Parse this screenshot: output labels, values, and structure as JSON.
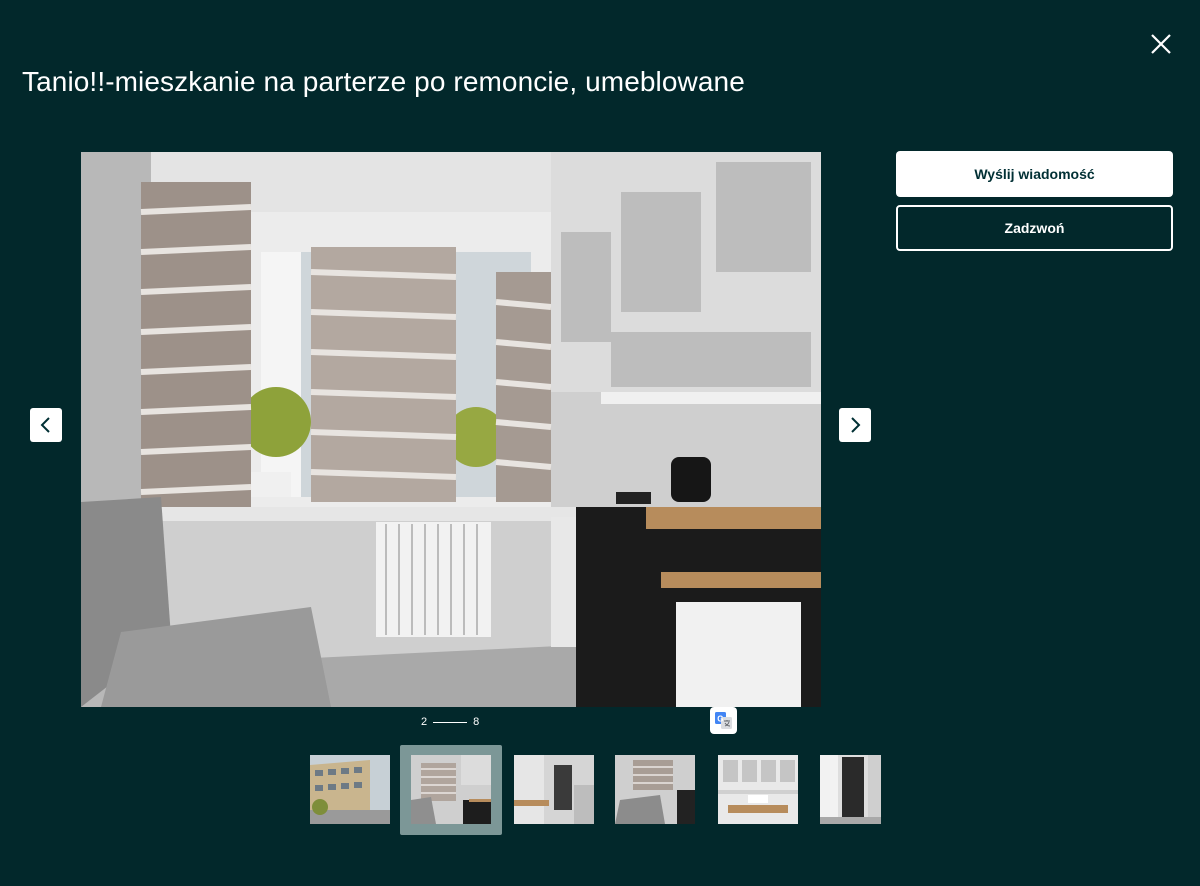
{
  "listing": {
    "title": "Tanio!!-mieszkanie na parterze po remoncie, umeblowane"
  },
  "gallery": {
    "current": "2",
    "total": "8",
    "thumbnail_count": 6,
    "active_thumbnail": 2
  },
  "actions": {
    "message_label": "Wyślij wiadomość",
    "call_label": "Zadzwoń"
  },
  "icons": {
    "close": "close-icon",
    "prev": "chevron-left-icon",
    "next": "chevron-right-icon",
    "translate": "google-translate-icon"
  },
  "colors": {
    "background": "#02282b",
    "button_text": "#002f34",
    "active_thumb_frame": "#7c9797"
  }
}
